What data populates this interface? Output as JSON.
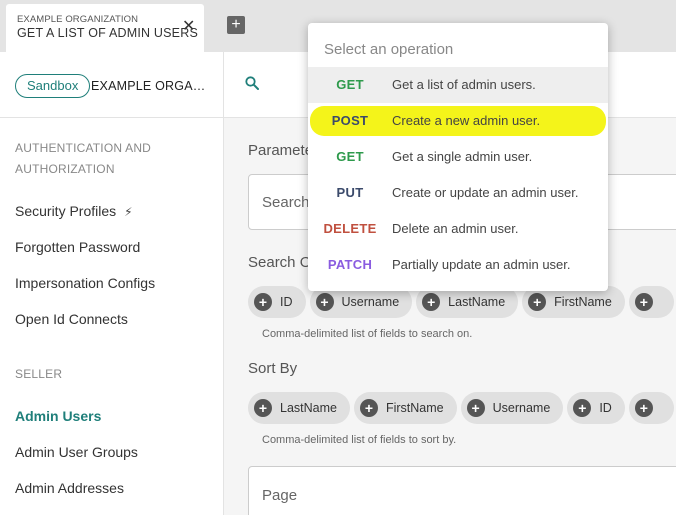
{
  "tab": {
    "organization": "EXAMPLE ORGANIZATION",
    "title": "GET A LIST OF ADMIN USERS",
    "close_glyph": "✕",
    "add_glyph": "+"
  },
  "sidebar": {
    "environment": "Sandbox",
    "organization": "EXAMPLE ORGANI...",
    "sections": [
      {
        "label": "AUTHENTICATION AND AUTHORIZATION",
        "items": [
          "Security Profiles",
          "Forgotten Password",
          "Impersonation Configs",
          "Open Id Connects"
        ]
      },
      {
        "label": "SELLER",
        "items": [
          "Admin Users",
          "Admin User Groups",
          "Admin Addresses"
        ]
      }
    ],
    "active_item": "Admin Users"
  },
  "main": {
    "parameters_label": "Paramete",
    "search_placeholder": "Search",
    "search_on_label": "Search O",
    "search_on_chips": [
      "ID",
      "Username",
      "LastName",
      "FirstName",
      ""
    ],
    "search_on_hint": "Comma-delimited list of fields to search on.",
    "sort_by_label": "Sort By",
    "sort_by_chips": [
      "LastName",
      "FirstName",
      "Username",
      "ID",
      ""
    ],
    "sort_by_hint": "Comma-delimited list of fields to sort by.",
    "page_placeholder": "Page"
  },
  "dropdown": {
    "placeholder": "Select an operation",
    "operations": [
      {
        "method": "GET",
        "description": "Get a list of admin users."
      },
      {
        "method": "POST",
        "description": "Create a new admin user."
      },
      {
        "method": "GET",
        "description": "Get a single admin user."
      },
      {
        "method": "PUT",
        "description": "Create or update an admin user."
      },
      {
        "method": "DELETE",
        "description": "Delete an admin user."
      },
      {
        "method": "PATCH",
        "description": "Partially update an admin user."
      }
    ]
  },
  "colors": {
    "accent": "#1f7f7a",
    "get": "#2e9a4c",
    "post": "#3b4a6b",
    "delete": "#c0503f",
    "patch": "#8a5ce0",
    "highlight": "#f4f41a"
  },
  "icons": {
    "search": "search-icon",
    "bolt": "lightning-icon",
    "plus": "plus-circle-icon"
  }
}
